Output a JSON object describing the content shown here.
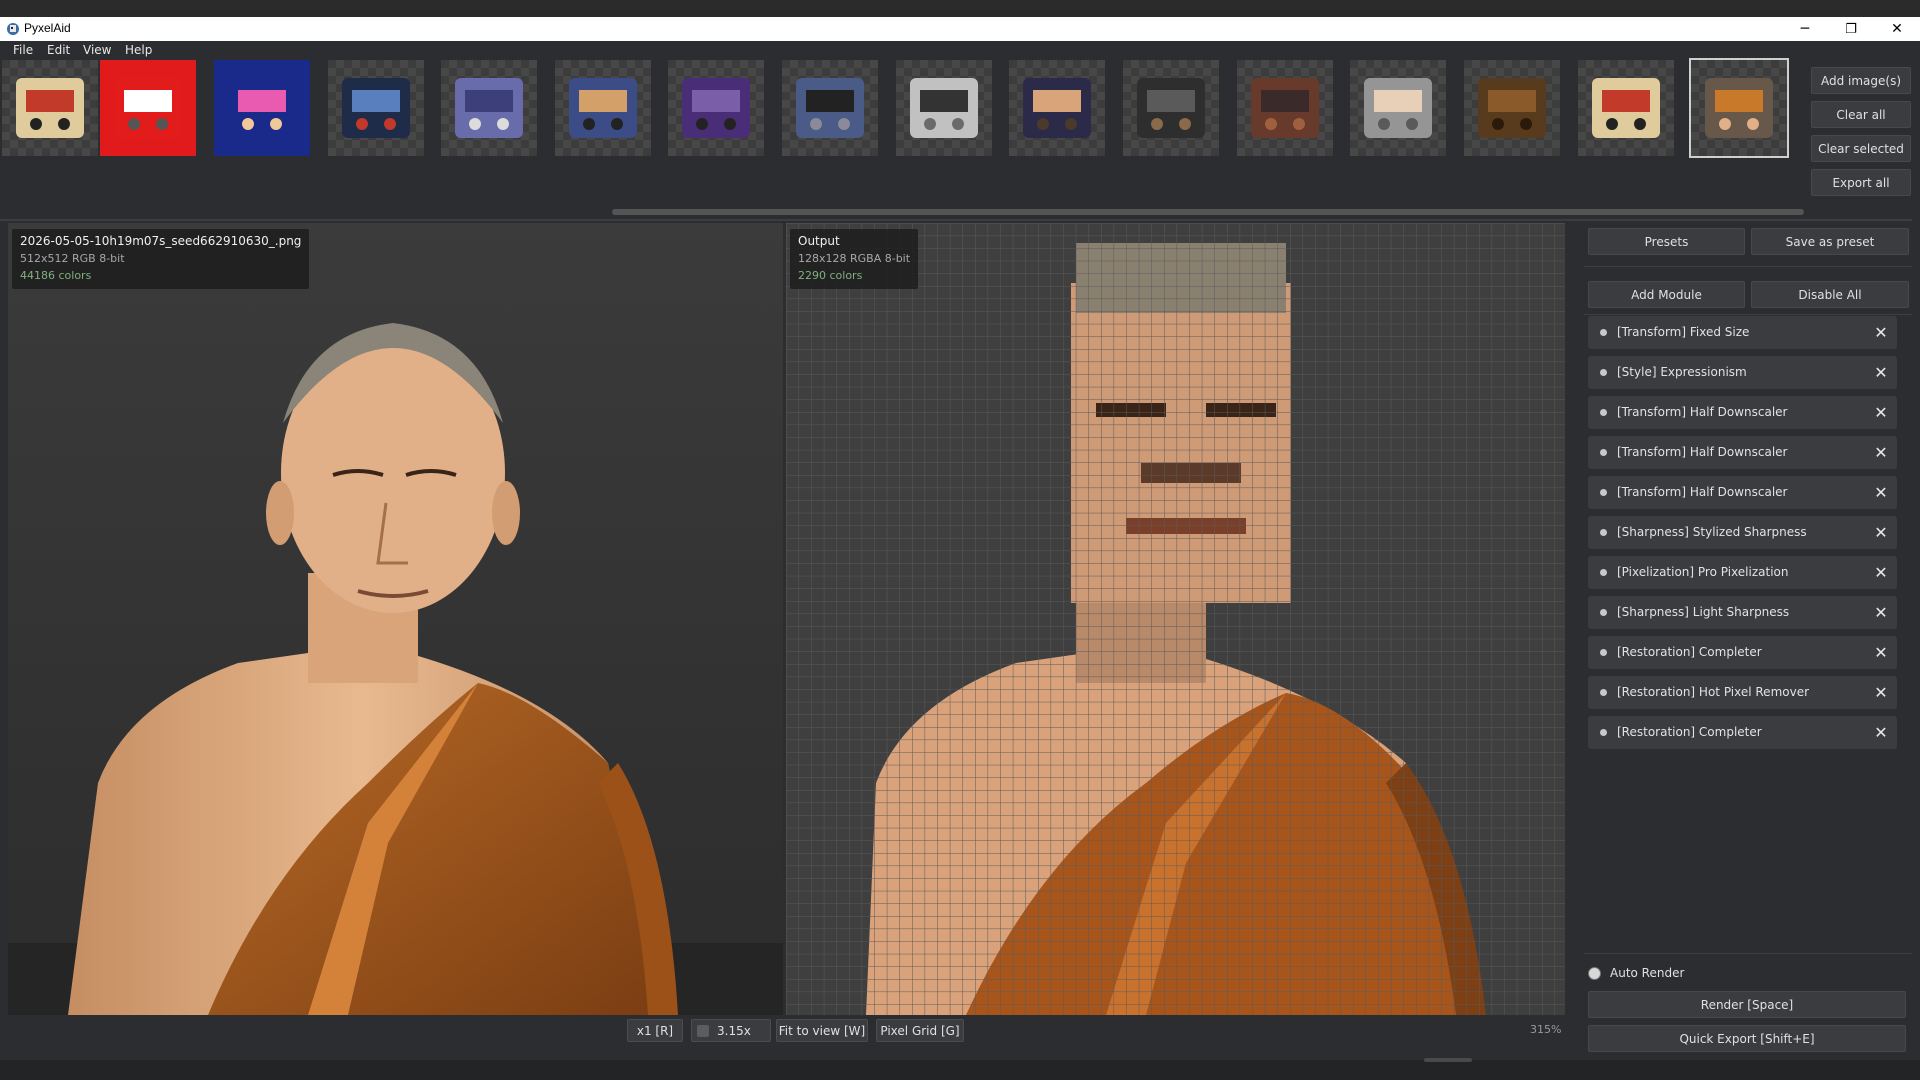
{
  "window": {
    "title": "PyxelAid",
    "minimize_glyph": "─",
    "restore_glyph": "❐",
    "close_glyph": "✕"
  },
  "menu": [
    "File",
    "Edit",
    "View",
    "Help"
  ],
  "thumbnails": [
    {
      "name": "mixtape-cassette"
    },
    {
      "name": "red-fallen-figure"
    },
    {
      "name": "dance-poster"
    },
    {
      "name": "city-skyline-torii"
    },
    {
      "name": "game-controllers"
    },
    {
      "name": "motorcycle-rider"
    },
    {
      "name": "werewolf-creature"
    },
    {
      "name": "sports-car"
    },
    {
      "name": "boombox"
    },
    {
      "name": "long-hair-hero"
    },
    {
      "name": "ninja-warrior"
    },
    {
      "name": "storefront-building"
    },
    {
      "name": "old-man-portrait"
    },
    {
      "name": "bigfoot"
    },
    {
      "name": "mixtape-cassette-2"
    },
    {
      "name": "monk-portrait",
      "selected": true
    }
  ],
  "image_buttons": {
    "add": "Add image(s)",
    "clear_all": "Clear all",
    "clear_selected": "Clear selected",
    "export_all": "Export all"
  },
  "input_view": {
    "filename": "2026-05-05-10h19m07s_seed662910630_.png",
    "meta": "512x512  RGB  8-bit",
    "colors": "44186 colors"
  },
  "output_view": {
    "label": "Output",
    "meta": "128x128  RGBA  8-bit",
    "colors": "2290 colors"
  },
  "bottom_bar": {
    "scale_button": "x1 [R]",
    "zoom_value": "3.15x",
    "fit_button": "Fit to view [W]",
    "grid_button": "Pixel Grid [G]",
    "zoom_percent": "315%"
  },
  "right_panel": {
    "presets": "Presets",
    "save_preset": "Save as preset",
    "add_module": "Add Module",
    "disable_all": "Disable All",
    "modules": [
      "[Transform] Fixed Size",
      "[Style] Expressionism",
      "[Transform] Half Downscaler",
      "[Transform] Half Downscaler",
      "[Transform] Half Downscaler",
      "[Sharpness] Stylized Sharpness",
      "[Pixelization] Pro Pixelization",
      "[Sharpness] Light Sharpness",
      "[Restoration] Completer",
      "[Restoration] Hot Pixel Remover",
      "[Restoration] Completer"
    ],
    "auto_render": "Auto Render",
    "render": "Render  [Space]",
    "quick_export": "Quick Export  [Shift+E]"
  }
}
